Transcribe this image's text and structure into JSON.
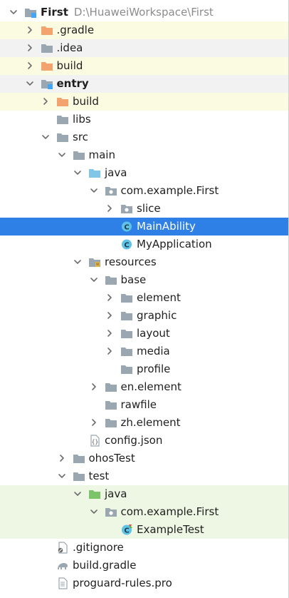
{
  "project_tree": {
    "rows": [
      {
        "label": "First",
        "path": "D:\\HuaweiWorkspace\\First",
        "depth": 0,
        "chevron": "down",
        "icon": "module-folder-icon",
        "bold": true,
        "bg": "none",
        "name": "tree-item-first"
      },
      {
        "label": ".gradle",
        "depth": 1,
        "chevron": "right",
        "icon": "excluded-folder-icon",
        "bg": "yellow",
        "name": "tree-item-gradle-dir"
      },
      {
        "label": ".idea",
        "depth": 1,
        "chevron": "right",
        "icon": "folder-icon",
        "bg": "grey",
        "name": "tree-item-idea"
      },
      {
        "label": "build",
        "depth": 1,
        "chevron": "right",
        "icon": "excluded-folder-icon",
        "bg": "yellow",
        "name": "tree-item-build"
      },
      {
        "label": "entry",
        "depth": 1,
        "chevron": "down",
        "icon": "module-folder-icon",
        "bold": true,
        "bg": "grey",
        "name": "tree-item-entry"
      },
      {
        "label": "build",
        "depth": 2,
        "chevron": "right",
        "icon": "excluded-folder-icon",
        "bg": "yellow",
        "name": "tree-item-entry-build"
      },
      {
        "label": "libs",
        "depth": 2,
        "chevron": "none",
        "icon": "folder-icon",
        "bg": "none",
        "name": "tree-item-libs"
      },
      {
        "label": "src",
        "depth": 2,
        "chevron": "down",
        "icon": "folder-icon",
        "bg": "none",
        "name": "tree-item-src"
      },
      {
        "label": "main",
        "depth": 3,
        "chevron": "down",
        "icon": "folder-icon",
        "bg": "none",
        "name": "tree-item-main"
      },
      {
        "label": "java",
        "depth": 4,
        "chevron": "down",
        "icon": "source-folder-icon",
        "bg": "none",
        "name": "tree-item-java"
      },
      {
        "label": "com.example.First",
        "depth": 5,
        "chevron": "down",
        "icon": "package-icon",
        "bg": "none",
        "name": "tree-item-package-main"
      },
      {
        "label": "slice",
        "depth": 6,
        "chevron": "right",
        "icon": "package-icon",
        "bg": "none",
        "name": "tree-item-slice"
      },
      {
        "label": "MainAbility",
        "depth": 6,
        "chevron": "none",
        "icon": "class-icon",
        "bg": "selected",
        "name": "tree-item-mainability"
      },
      {
        "label": "MyApplication",
        "depth": 6,
        "chevron": "none",
        "icon": "class-icon",
        "bg": "none",
        "name": "tree-item-myapplication"
      },
      {
        "label": "resources",
        "depth": 4,
        "chevron": "down",
        "icon": "resources-folder-icon",
        "bg": "none",
        "name": "tree-item-resources"
      },
      {
        "label": "base",
        "depth": 5,
        "chevron": "down",
        "icon": "folder-icon",
        "bg": "none",
        "name": "tree-item-base"
      },
      {
        "label": "element",
        "depth": 6,
        "chevron": "right",
        "icon": "folder-icon",
        "bg": "none",
        "name": "tree-item-element"
      },
      {
        "label": "graphic",
        "depth": 6,
        "chevron": "right",
        "icon": "folder-icon",
        "bg": "none",
        "name": "tree-item-graphic"
      },
      {
        "label": "layout",
        "depth": 6,
        "chevron": "right",
        "icon": "folder-icon",
        "bg": "none",
        "name": "tree-item-layout"
      },
      {
        "label": "media",
        "depth": 6,
        "chevron": "right",
        "icon": "folder-icon",
        "bg": "none",
        "name": "tree-item-media"
      },
      {
        "label": "profile",
        "depth": 6,
        "chevron": "none",
        "icon": "folder-icon",
        "bg": "none",
        "name": "tree-item-profile"
      },
      {
        "label": "en.element",
        "depth": 5,
        "chevron": "right",
        "icon": "folder-icon",
        "bg": "none",
        "name": "tree-item-en-element"
      },
      {
        "label": "rawfile",
        "depth": 5,
        "chevron": "none",
        "icon": "folder-icon",
        "bg": "none",
        "name": "tree-item-rawfile"
      },
      {
        "label": "zh.element",
        "depth": 5,
        "chevron": "right",
        "icon": "folder-icon",
        "bg": "none",
        "name": "tree-item-zh-element"
      },
      {
        "label": "config.json",
        "depth": 4,
        "chevron": "none",
        "icon": "json-file-icon",
        "bg": "none",
        "name": "tree-item-config-json"
      },
      {
        "label": "ohosTest",
        "depth": 3,
        "chevron": "right",
        "icon": "folder-icon",
        "bg": "none",
        "name": "tree-item-ohostest"
      },
      {
        "label": "test",
        "depth": 3,
        "chevron": "down",
        "icon": "folder-icon",
        "bg": "none",
        "name": "tree-item-test"
      },
      {
        "label": "java",
        "depth": 4,
        "chevron": "down",
        "icon": "test-source-folder-icon",
        "bg": "green",
        "name": "tree-item-test-java"
      },
      {
        "label": "com.example.First",
        "depth": 5,
        "chevron": "down",
        "icon": "package-icon",
        "bg": "green",
        "name": "tree-item-package-test"
      },
      {
        "label": "ExampleTest",
        "depth": 6,
        "chevron": "none",
        "icon": "test-class-icon",
        "bg": "green",
        "name": "tree-item-exampletest"
      },
      {
        "label": ".gitignore",
        "depth": 2,
        "chevron": "none",
        "icon": "gitignore-file-icon",
        "bg": "none",
        "name": "tree-item-gitignore"
      },
      {
        "label": "build.gradle",
        "depth": 2,
        "chevron": "none",
        "icon": "gradle-file-icon",
        "bg": "none",
        "name": "tree-item-build-gradle"
      },
      {
        "label": "proguard-rules.pro",
        "depth": 2,
        "chevron": "none",
        "icon": "text-file-icon",
        "bg": "none",
        "name": "tree-item-proguard-rules"
      }
    ]
  },
  "colors": {
    "selected_bg": "#2e7fe6",
    "excluded_bg": "#fbfbe2",
    "test_bg": "#eef7e4",
    "folder": "#9aa7b0",
    "excluded_folder": "#f3a46e",
    "source_folder": "#7fc6e8",
    "test_folder": "#7cc46a",
    "class_icon": "#5ec3e6",
    "module_badge": "#42a5f5"
  }
}
